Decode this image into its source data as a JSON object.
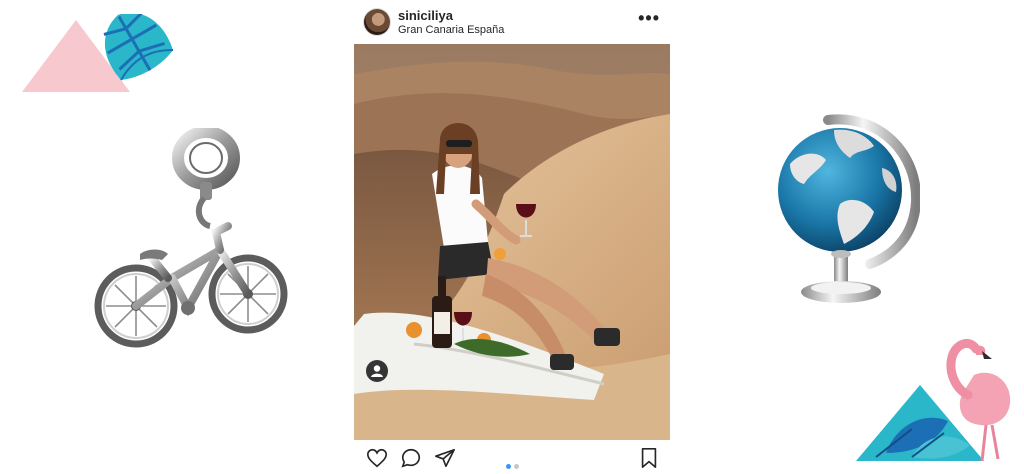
{
  "post": {
    "username": "siniciliya",
    "location": "Gran Canaria España",
    "more_glyph": "•••",
    "carousel": {
      "count": 2,
      "active_index": 0
    }
  },
  "icons": {
    "avatar": "user-avatar",
    "more": "more-options-icon",
    "tag": "user-tag-icon",
    "like": "heart-icon",
    "comment": "comment-icon",
    "share": "paper-plane-icon",
    "save": "bookmark-icon"
  },
  "colors": {
    "accent": "#3897f0",
    "text": "#262626",
    "dot_inactive": "#c7c7c7",
    "deco_pink": "#f7c9cf",
    "deco_teal": "#2ab7c9",
    "deco_blue": "#1c6fb5",
    "globe_blue": "#1a77a8"
  }
}
